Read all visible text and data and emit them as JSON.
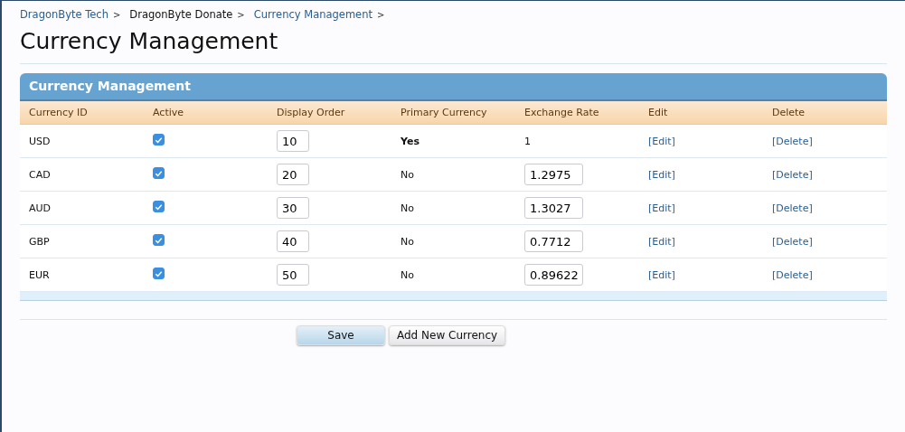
{
  "breadcrumb": [
    {
      "label": "DragonByte Tech",
      "link": true,
      "separator": ">"
    },
    {
      "label": "DragonByte Donate",
      "link": false,
      "separator": ">"
    },
    {
      "label": "Currency Management",
      "link": true,
      "separator": ">"
    }
  ],
  "title": "Currency Management",
  "panel": {
    "title": "Currency Management",
    "columns": [
      "Currency ID",
      "Active",
      "Display Order",
      "Primary Currency",
      "Exchange Rate",
      "Edit",
      "Delete"
    ],
    "rows": [
      {
        "currency_id": "USD",
        "active": true,
        "display_order": "10",
        "primary": true,
        "primary_currency": "Yes",
        "exchange_rate": {
          "kind": "text",
          "value": "1"
        },
        "edit": "[Edit]",
        "delete": "[Delete]"
      },
      {
        "currency_id": "CAD",
        "active": true,
        "display_order": "20",
        "primary": false,
        "primary_currency": "No",
        "exchange_rate": {
          "kind": "input",
          "value": "1.2975"
        },
        "edit": "[Edit]",
        "delete": "[Delete]"
      },
      {
        "currency_id": "AUD",
        "active": true,
        "display_order": "30",
        "primary": false,
        "primary_currency": "No",
        "exchange_rate": {
          "kind": "input",
          "value": "1.3027"
        },
        "edit": "[Edit]",
        "delete": "[Delete]"
      },
      {
        "currency_id": "GBP",
        "active": true,
        "display_order": "40",
        "primary": false,
        "primary_currency": "No",
        "exchange_rate": {
          "kind": "input",
          "value": "0.7712"
        },
        "edit": "[Edit]",
        "delete": "[Delete]"
      },
      {
        "currency_id": "EUR",
        "active": true,
        "display_order": "50",
        "primary": false,
        "primary_currency": "No",
        "exchange_rate": {
          "kind": "input",
          "value": "0.89622"
        },
        "edit": "[Edit]",
        "delete": "[Delete]"
      }
    ]
  },
  "buttons": [
    "Save",
    "Add New Currency"
  ]
}
